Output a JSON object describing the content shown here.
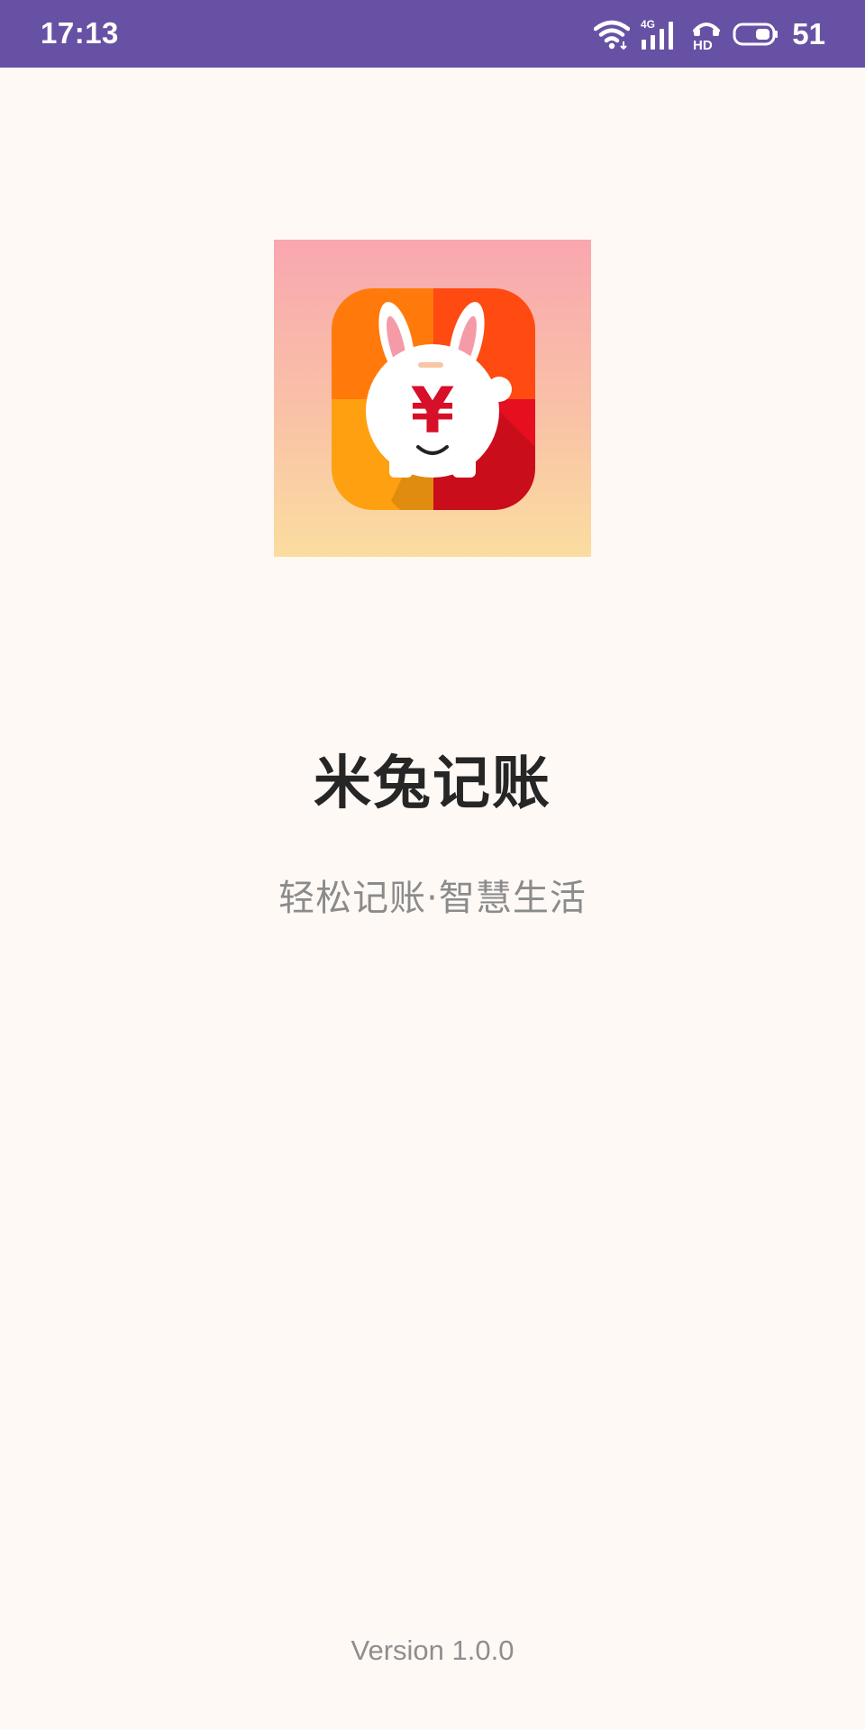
{
  "status_bar": {
    "time": "17:13",
    "network_label": "4G",
    "hd_label": "HD",
    "battery_level": "51",
    "icons": [
      "wifi-icon",
      "signal-icon",
      "hd-call-icon",
      "battery-icon"
    ],
    "background_color": "#6751A4"
  },
  "splash": {
    "app_icon": "piggy-bank-rabbit-icon",
    "app_icon_symbol": "¥",
    "app_name": "米兔记账",
    "slogan": "轻松记账·智慧生活",
    "version": "Version 1.0.0"
  },
  "colors": {
    "background": "#FFF9F6",
    "title": "#262626",
    "slogan": "#8B8B8B",
    "version": "#8E8E8E",
    "icon_orange": "#FF7A1A",
    "icon_red": "#E60F1F"
  }
}
